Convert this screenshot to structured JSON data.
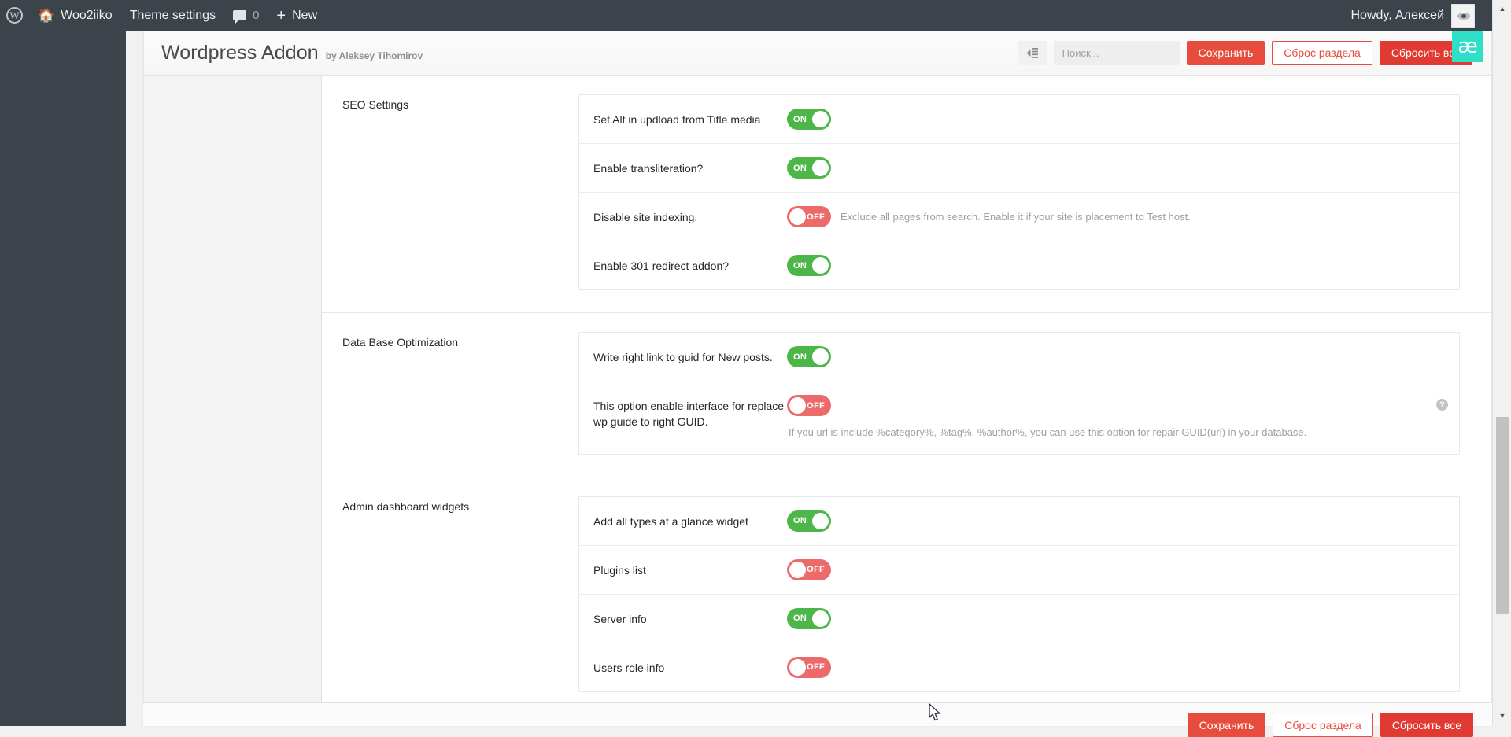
{
  "adminbar": {
    "logo_icon": "wordpress-logo-icon",
    "home_icon": "home-icon",
    "site_name": "Woo2iiko",
    "theme_settings": "Theme settings",
    "comments_icon": "comment-bubble-icon",
    "comments_count": "0",
    "new_icon": "plus-icon",
    "new_label": "New",
    "howdy": "Howdy, Алексей",
    "avatar_icon": "avatar",
    "badge_text": "æ"
  },
  "header": {
    "title": "Wordpress Addon",
    "byline": "by Aleksey Tihomirov",
    "collapse_icon": "collapse-sidebar-icon",
    "search_placeholder": "Поиск...",
    "search_value": "",
    "save_label": "Сохранить",
    "reset_section_label": "Сброс раздела",
    "reset_all_label": "Сбросить все"
  },
  "footer": {
    "save_label": "Сохранить",
    "reset_section_label": "Сброс раздела",
    "reset_all_label": "Сбросить все"
  },
  "colors": {
    "accent_red": "#e74c3c",
    "danger_red": "#e03a32",
    "toggle_on": "#4cb748",
    "toggle_off": "#ed6a6a",
    "adminbar": "#3c434a",
    "badge_teal": "#2ee0c8"
  },
  "toggle_labels": {
    "on": "ON",
    "off": "OFF"
  },
  "sections": [
    {
      "title": "SEO Settings",
      "rows": [
        {
          "label": "Set Alt in updload from Title media",
          "state": "on",
          "desc": "",
          "desc_below": false,
          "help": false
        },
        {
          "label": "Enable transliteration?",
          "state": "on",
          "desc": "",
          "desc_below": false,
          "help": false
        },
        {
          "label": "Disable site indexing.",
          "state": "off",
          "desc": "Exclude all pages from search. Enable it if your site is placement to Test host.",
          "desc_below": false,
          "help": false
        },
        {
          "label": "Enable 301 redirect addon?",
          "state": "on",
          "desc": "",
          "desc_below": false,
          "help": false
        }
      ]
    },
    {
      "title": "Data Base Optimization",
      "rows": [
        {
          "label": "Write right link to guid for New posts.",
          "state": "on",
          "desc": "",
          "desc_below": false,
          "help": false
        },
        {
          "label": "This option enable interface for replace wp guide to right GUID.",
          "state": "off",
          "desc": "If you url is include %category%, %tag%, %author%, you can use this option for repair GUID(url) in your database.",
          "desc_below": true,
          "help": true
        }
      ]
    },
    {
      "title": "Admin dashboard widgets",
      "rows": [
        {
          "label": "Add all types at a glance widget",
          "state": "on",
          "desc": "",
          "desc_below": false,
          "help": false
        },
        {
          "label": "Plugins list",
          "state": "off",
          "desc": "",
          "desc_below": false,
          "help": false
        },
        {
          "label": "Server info",
          "state": "on",
          "desc": "",
          "desc_below": false,
          "help": false
        },
        {
          "label": "Users role info",
          "state": "off",
          "desc": "",
          "desc_below": false,
          "help": false
        }
      ]
    }
  ],
  "scrollbar": {
    "up_arrow": "chevron-up-icon",
    "down_arrow": "chevron-down-icon"
  }
}
